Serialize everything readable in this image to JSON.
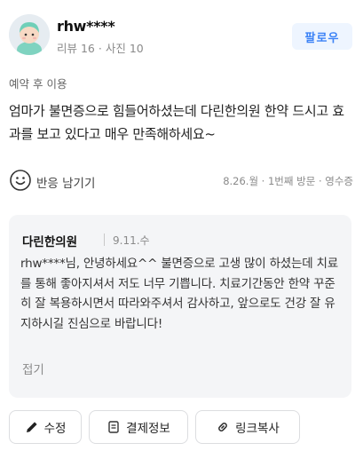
{
  "header": {
    "username": "rhw****",
    "review_count": "리뷰 16",
    "photo_count": "사진 10",
    "meta_separator": "·",
    "follow_label": "팔로우"
  },
  "review": {
    "tag": "예약 후 이용",
    "text": "엄마가 불면증으로 힘들어하셨는데 다린한의원 한약 드시고 효과를 보고 있다고 매우 만족해하세요~",
    "reaction_label": "반응 남기기",
    "visit_info": "8.26.월 · 1번째 방문 · 영수증"
  },
  "reply": {
    "owner_name": "다린한의원",
    "date": "9.11.수",
    "text": "rhw****님, 안녕하세요^^ 불면증으로 고생 많이 하셨는데 치료를 통해 좋아지셔서 저도 너무 기쁩니다. 치료기간동안 한약 꾸준히 잘 복용하시면서 따라와주셔서 감사하고, 앞으로도 건강 잘 유지하시길 진심으로 바랍니다!",
    "fold_label": "접기"
  },
  "actions": {
    "edit_label": "수정",
    "payment_label": "결제정보",
    "copy_link_label": "링크복사"
  },
  "icons": [
    "avatar",
    "smile-icon",
    "pencil-icon",
    "receipt-icon",
    "link-icon"
  ],
  "colors": {
    "accent": "#3b82f6",
    "reply_bg": "#f4f5f7"
  }
}
